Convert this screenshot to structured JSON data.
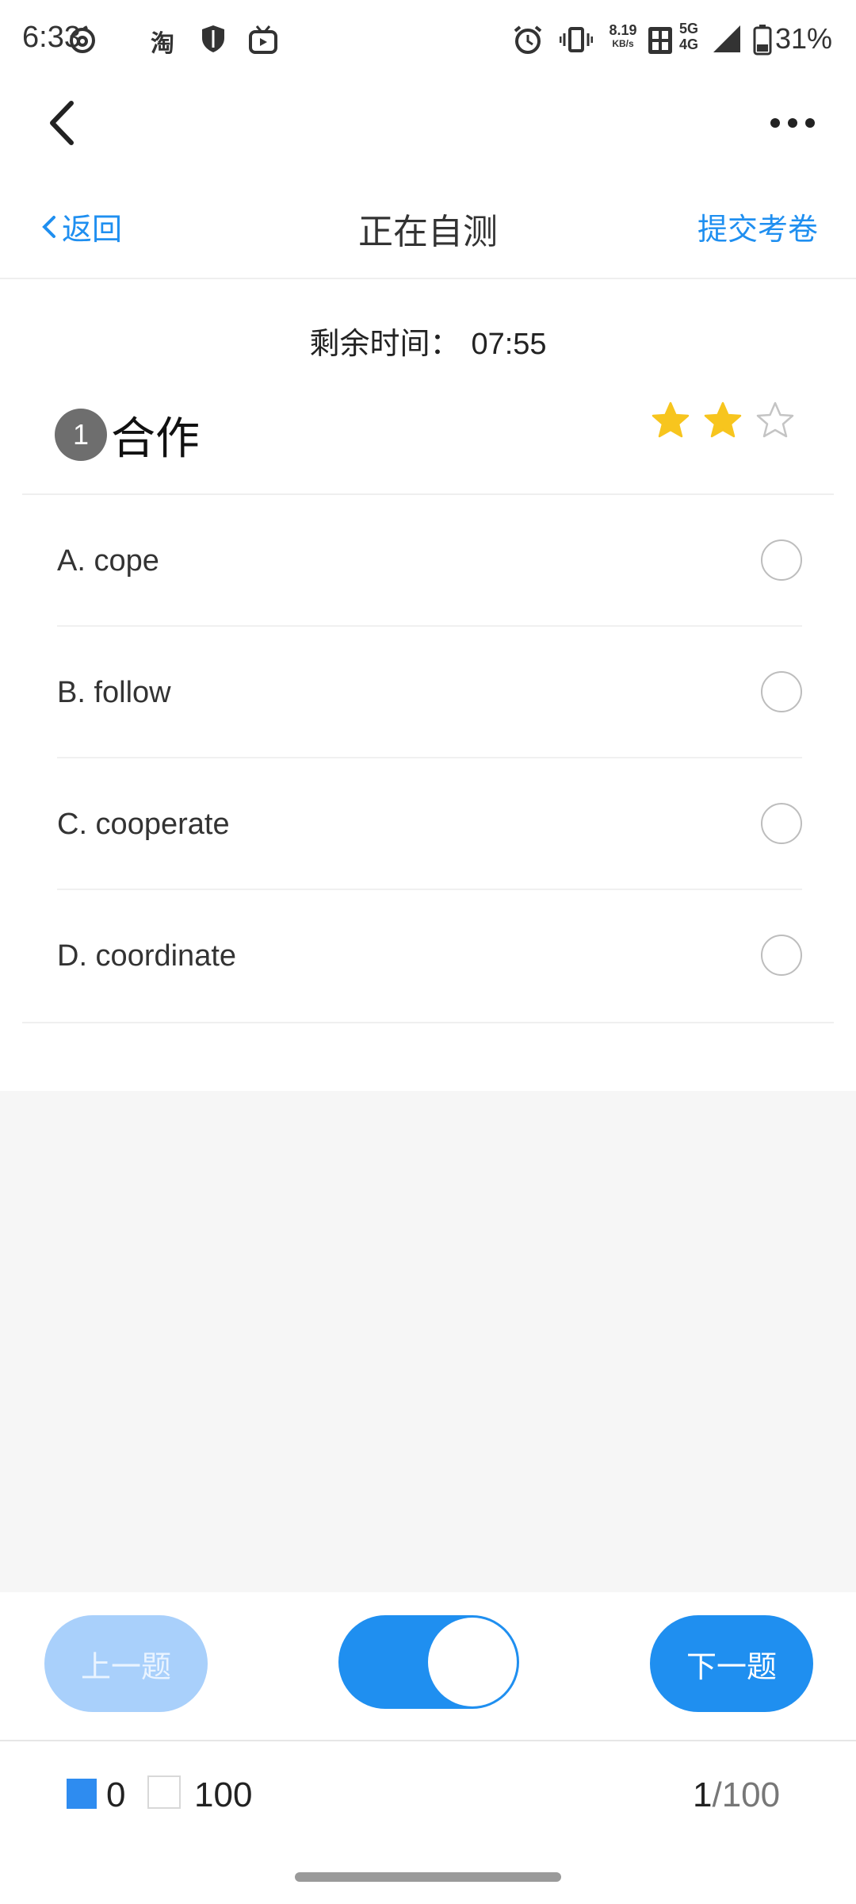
{
  "status_bar": {
    "time": "6:33",
    "speed_value": "8.19",
    "speed_unit": "KB/s",
    "network_5g": "5G",
    "network_4g": "4G",
    "battery": "31%",
    "left_icons": [
      "netease-music-icon",
      "taobao-icon",
      "shield-icon",
      "bilibili-tv-icon"
    ],
    "taobao_glyph": "淘"
  },
  "header": {
    "back_label": "返回",
    "title": "正在自测",
    "submit_label": "提交考卷"
  },
  "timer": {
    "label": "剩余时间：",
    "value": "07:55"
  },
  "question": {
    "number": "1",
    "text": "合作",
    "difficulty_stars": 2,
    "difficulty_max": 3,
    "star_color": "#f7c51e"
  },
  "options": [
    {
      "label": "A. cope"
    },
    {
      "label": "B. follow"
    },
    {
      "label": "C. cooperate"
    },
    {
      "label": "D. coordinate"
    }
  ],
  "controls": {
    "prev_label": "上一题",
    "next_label": "下一题",
    "toggle_on": true,
    "accent_color": "#1f8ff0"
  },
  "footer": {
    "answered_count": "0",
    "unanswered_count": "100",
    "current": "1",
    "total": "/100"
  }
}
